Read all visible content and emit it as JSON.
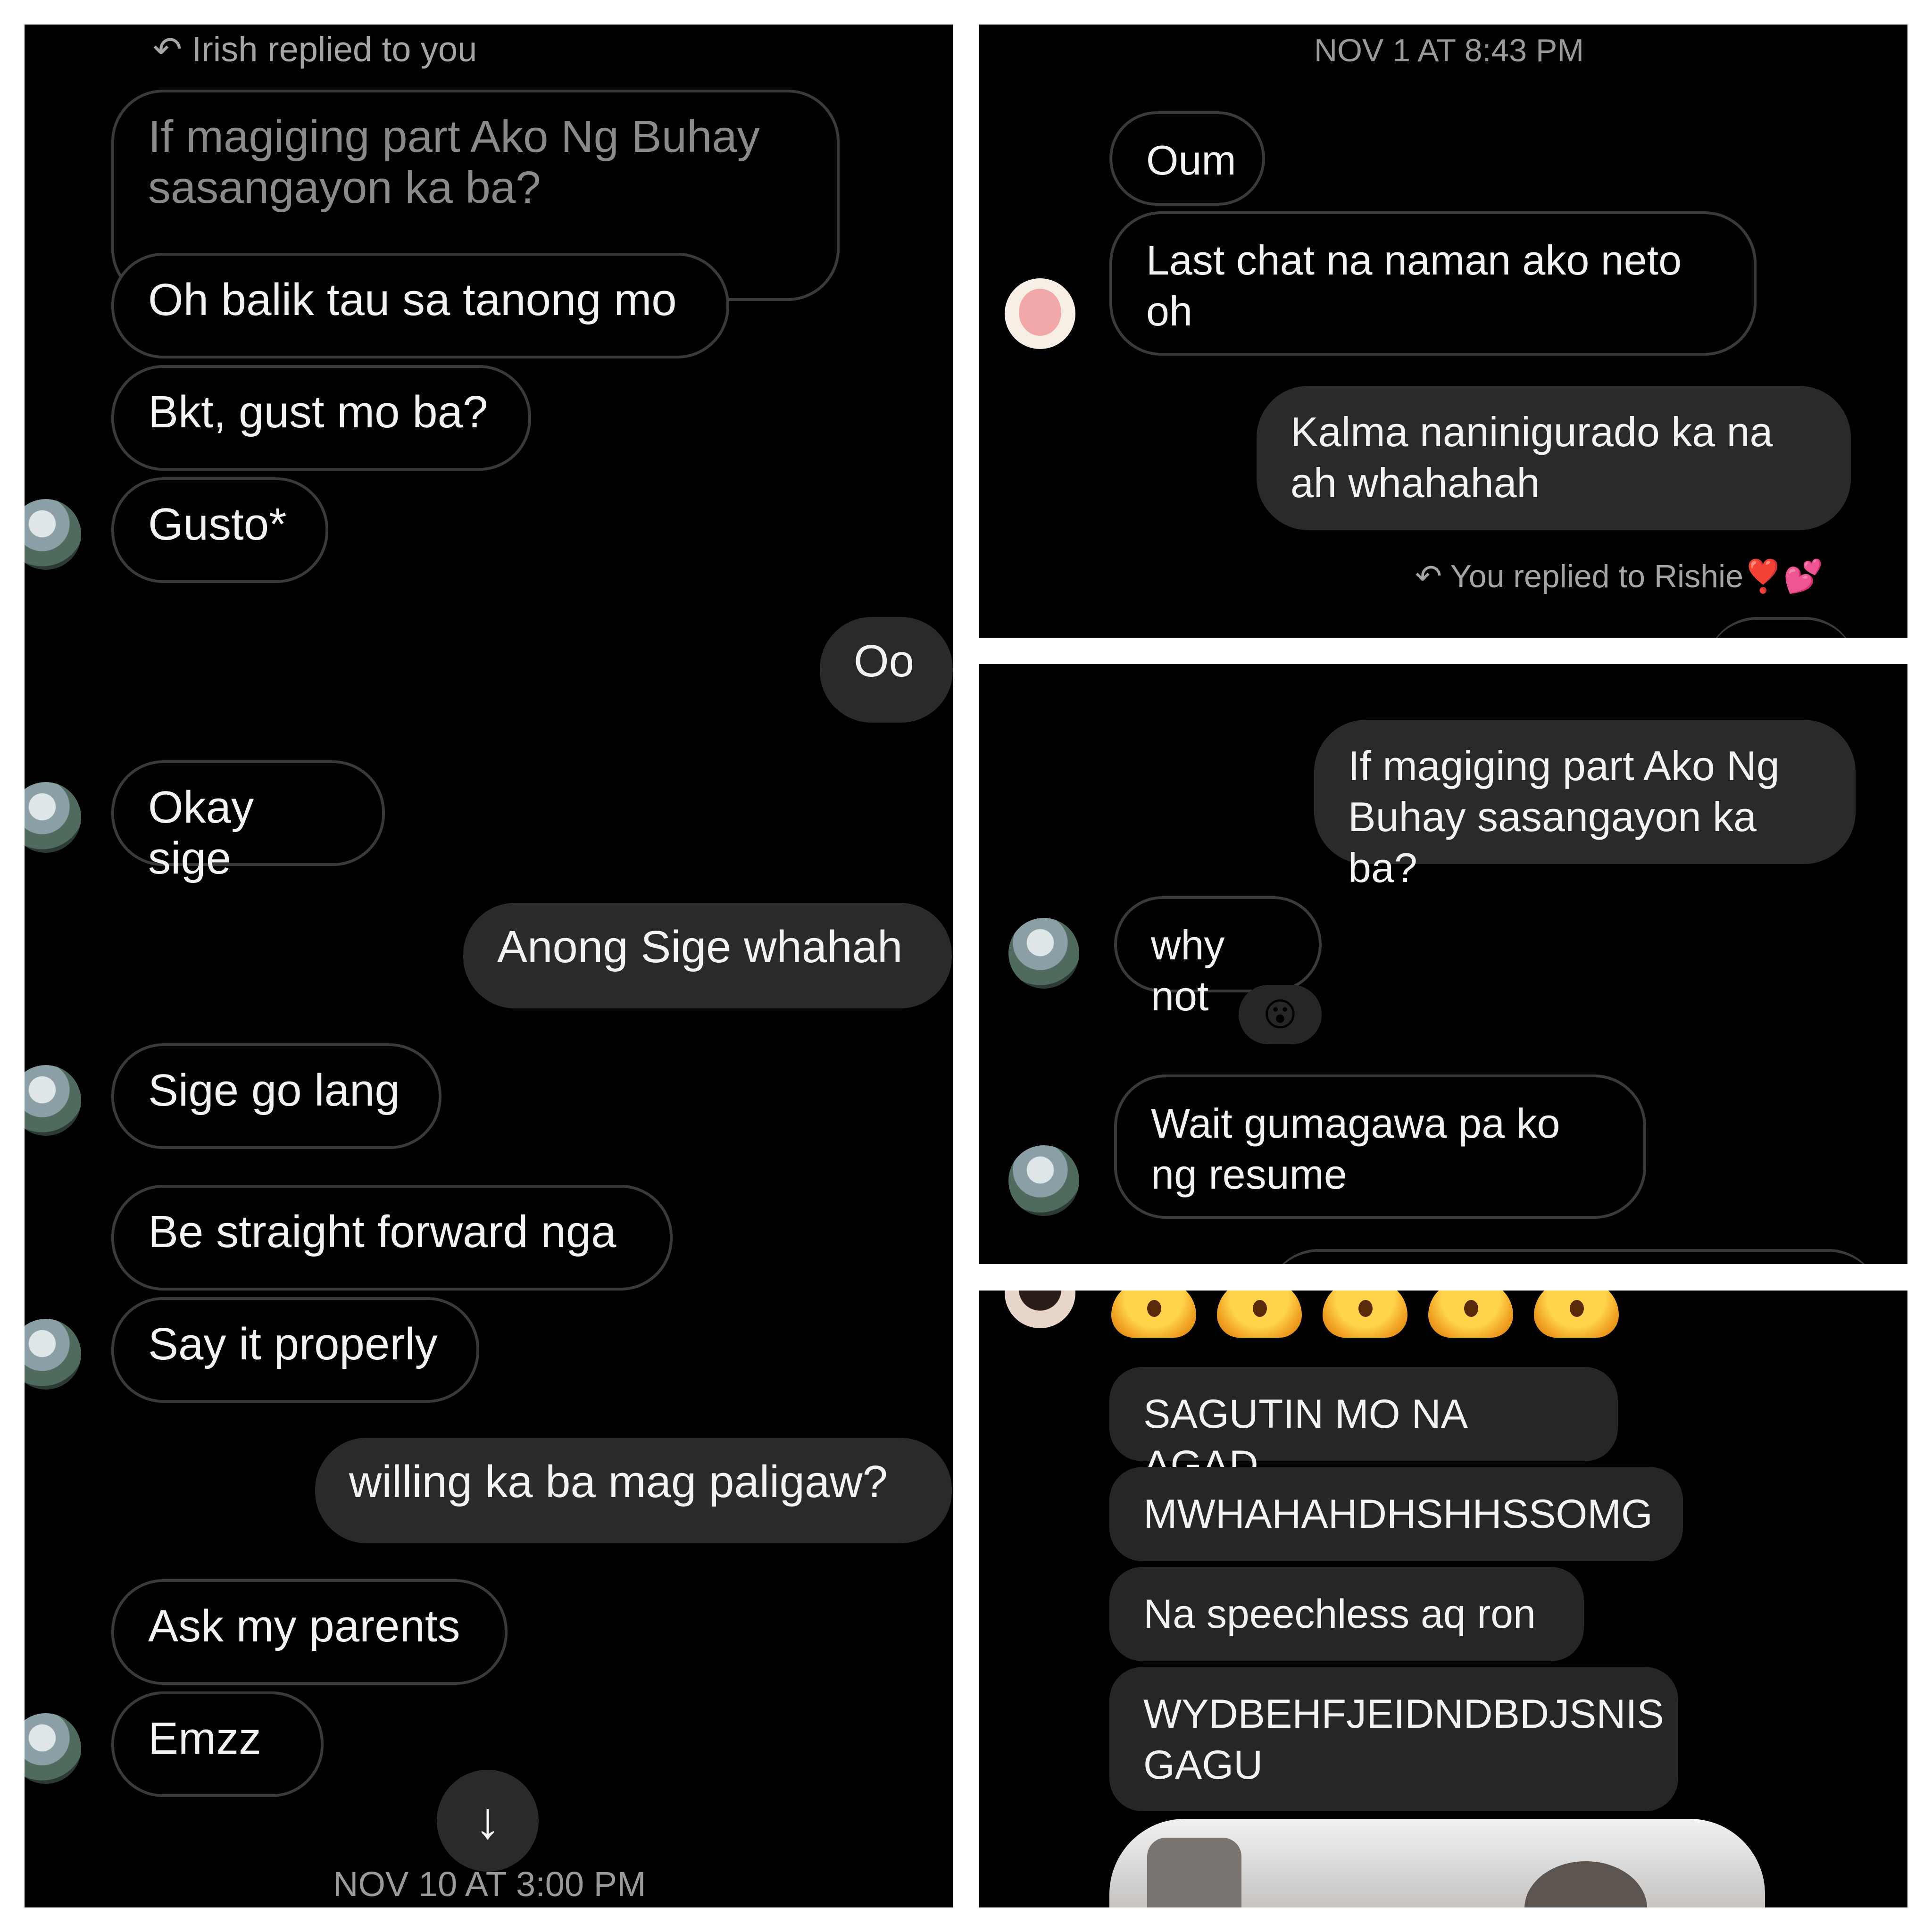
{
  "left_panel": {
    "reply_label": "Irish replied to you",
    "quoted_text": "If magiging part Ako Ng Buhay sasangayon ka ba?",
    "messages": [
      {
        "text": "Oh balik tau sa tanong mo",
        "side": "received"
      },
      {
        "text": "Bkt, gust mo ba?",
        "side": "received"
      },
      {
        "text": "Gusto*",
        "side": "received"
      },
      {
        "text": "Oo",
        "side": "sent"
      },
      {
        "text": "Okay sige",
        "side": "received"
      },
      {
        "text": "Anong Sige whahah",
        "side": "sent"
      },
      {
        "text": "Sige go lang",
        "side": "received"
      },
      {
        "text": "Be straight forward nga",
        "side": "received"
      },
      {
        "text": "Say it properly",
        "side": "received"
      },
      {
        "text": "willing ka ba mag paligaw?",
        "side": "sent"
      },
      {
        "text": "Ask my parents",
        "side": "received"
      },
      {
        "text": "Emzz",
        "side": "received"
      }
    ],
    "scroll_down_icon": "arrow-down-icon",
    "timestamp": "NOV 10 AT 3:00 PM"
  },
  "top_right_panel": {
    "timestamp": "NOV 1 AT 8:43 PM",
    "messages": [
      {
        "text": "Oum",
        "side": "received"
      },
      {
        "text": "Last chat na naman ako neto oh",
        "side": "received"
      },
      {
        "text": "Kalma naninigurado ka na ah whahahah",
        "side": "sent"
      }
    ],
    "reply_label": "You replied to Rishie❣️💕"
  },
  "mid_right_panel": {
    "messages": [
      {
        "text": "If magiging part Ako Ng Buhay sasangayon ka ba?",
        "side": "sent"
      },
      {
        "text": "why not",
        "side": "received",
        "reaction": "😮"
      },
      {
        "text": "Wait gumagawa pa ko ng resume",
        "side": "received"
      }
    ]
  },
  "bottom_right_panel": {
    "emoji_row": "😮😮😮😮😮",
    "messages": [
      {
        "text": "SAGUTIN MO NA AGAD",
        "side": "received"
      },
      {
        "text": "MWHAHAHDHSHHSSOMG",
        "side": "received"
      },
      {
        "text": "Na speechless aq ron",
        "side": "received"
      },
      {
        "text": "WYDBEHFJEIDNDBDJSNIS GAGU",
        "side": "received"
      }
    ]
  },
  "colors": {
    "background": "#000000",
    "sent_bubble": "#2a2a2a",
    "received_border": "#3a3a3a",
    "text": "#f2f2f2",
    "meta_text": "#9a9a9a"
  }
}
